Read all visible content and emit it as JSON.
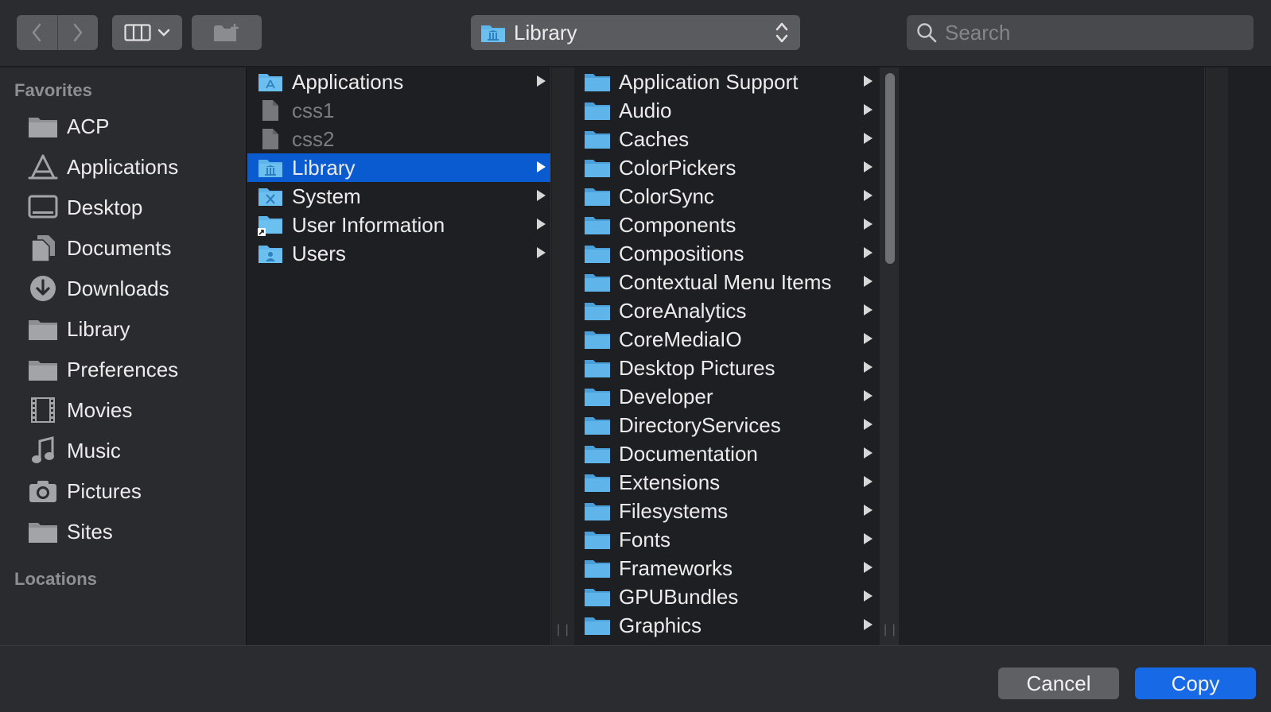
{
  "toolbar": {
    "path_label": "Library",
    "search_placeholder": "Search"
  },
  "sidebar": {
    "favorites_header": "Favorites",
    "locations_header": "Locations",
    "items": [
      {
        "label": "ACP",
        "icon": "folder-icon"
      },
      {
        "label": "Applications",
        "icon": "applications-icon"
      },
      {
        "label": "Desktop",
        "icon": "desktop-icon"
      },
      {
        "label": "Documents",
        "icon": "documents-icon"
      },
      {
        "label": "Downloads",
        "icon": "downloads-icon"
      },
      {
        "label": "Library",
        "icon": "folder-icon"
      },
      {
        "label": "Preferences",
        "icon": "folder-icon"
      },
      {
        "label": "Movies",
        "icon": "movies-icon"
      },
      {
        "label": "Music",
        "icon": "music-icon"
      },
      {
        "label": "Pictures",
        "icon": "pictures-icon"
      },
      {
        "label": "Sites",
        "icon": "folder-icon"
      }
    ]
  },
  "column1": {
    "items": [
      {
        "label": "Applications",
        "icon": "applications-folder-icon",
        "has_children": true
      },
      {
        "label": "css1",
        "icon": "file-icon",
        "has_children": false
      },
      {
        "label": "css2",
        "icon": "file-icon",
        "has_children": false
      },
      {
        "label": "Library",
        "icon": "library-folder-icon",
        "has_children": true,
        "selected": true
      },
      {
        "label": "System",
        "icon": "system-folder-icon",
        "has_children": true
      },
      {
        "label": "User Information",
        "icon": "alias-folder-icon",
        "has_children": true
      },
      {
        "label": "Users",
        "icon": "users-folder-icon",
        "has_children": true
      }
    ]
  },
  "column2": {
    "items": [
      "Application Support",
      "Audio",
      "Caches",
      "ColorPickers",
      "ColorSync",
      "Components",
      "Compositions",
      "Contextual Menu Items",
      "CoreAnalytics",
      "CoreMediaIO",
      "Desktop Pictures",
      "Developer",
      "DirectoryServices",
      "Documentation",
      "Extensions",
      "Filesystems",
      "Fonts",
      "Frameworks",
      "GPUBundles",
      "Graphics"
    ]
  },
  "footer": {
    "cancel_label": "Cancel",
    "copy_label": "Copy"
  },
  "colors": {
    "selection": "#0a5ad0",
    "folder_blue": "#5fb4ea",
    "primary_button": "#1769e6"
  }
}
